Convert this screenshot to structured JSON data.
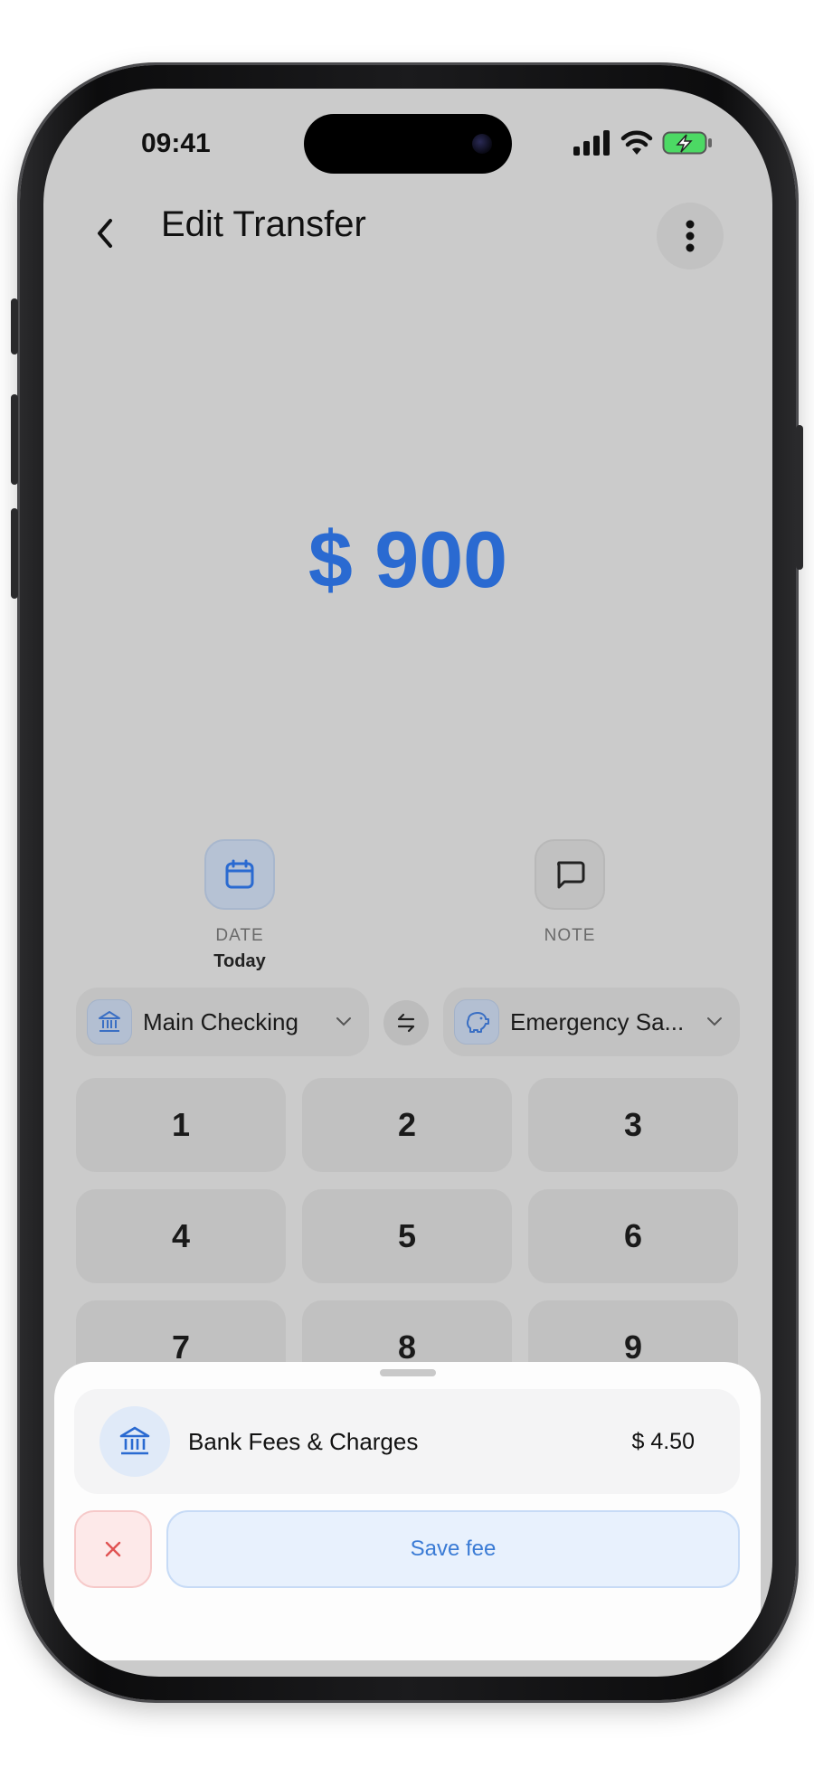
{
  "status_bar": {
    "time": "09:41"
  },
  "header": {
    "title": "Edit Transfer"
  },
  "amount": {
    "display": "$ 900"
  },
  "actions": {
    "date": {
      "label": "DATE",
      "value": "Today"
    },
    "note": {
      "label": "NOTE"
    }
  },
  "accounts": {
    "from": {
      "name": "Main Checking",
      "icon": "bank-icon"
    },
    "to": {
      "name": "Emergency Sa...",
      "icon": "piggy-bank-icon"
    }
  },
  "keypad": {
    "keys": [
      "1",
      "2",
      "3",
      "4",
      "5",
      "6",
      "7",
      "8",
      "9"
    ]
  },
  "fee_sheet": {
    "fee_name": "Bank Fees & Charges",
    "fee_amount": "$ 4.50",
    "save_label": "Save fee"
  },
  "colors": {
    "accent": "#2a6ad1",
    "danger": "#e05252",
    "overlay": "#cbcbcb"
  }
}
